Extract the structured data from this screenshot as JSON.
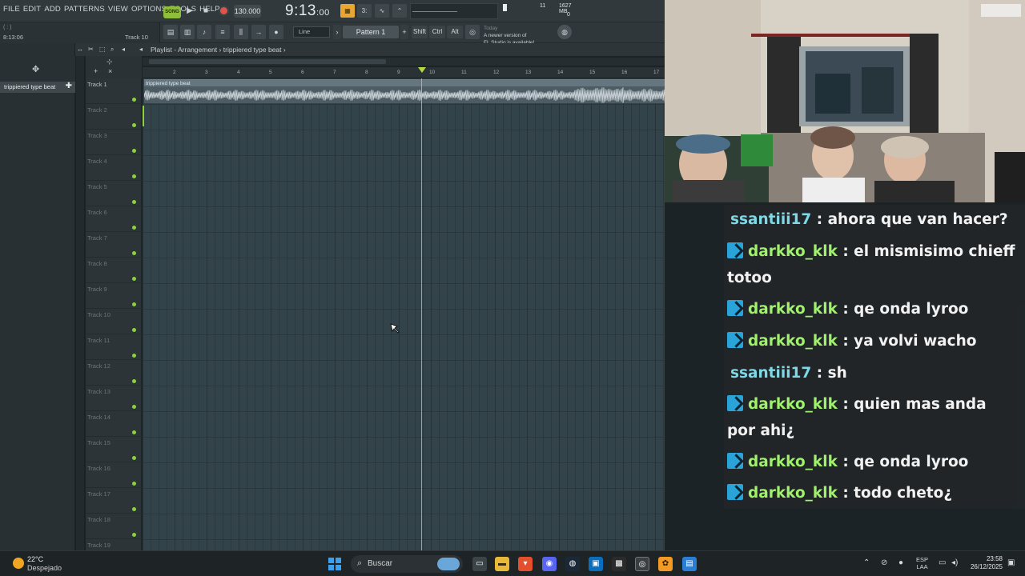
{
  "fl": {
    "menu": [
      "FILE",
      "EDIT",
      "ADD",
      "PATTERNS",
      "VIEW",
      "OPTIONS",
      "TOOLS",
      "HELP"
    ],
    "hint_top": "( : )",
    "hint_time": "8:13:06",
    "hint_track": "Track 10",
    "song_label": "SONG",
    "tempo": "130.000",
    "clock_main": "9:13",
    "clock_sub": ":00",
    "cpu_value": "11",
    "memory": "1627 MB",
    "poly": "0",
    "snap": "Line",
    "pattern": "Pattern 1",
    "modifiers": [
      "Shift",
      "Ctrl",
      "Alt"
    ],
    "news_label": "Today",
    "news_line1": "A newer version of",
    "news_line2": "FL Studio is available!",
    "breadcrumb": "Playlist - Arrangement",
    "breadcrumb_sep": "›",
    "breadcrumb_item": "trippiered type beat",
    "breadcrumb_tail": "›",
    "picker_pattern": "trippiered type beat",
    "clip_name": "trippiered type beat",
    "ruler": [
      "2",
      "3",
      "4",
      "5",
      "6",
      "7",
      "8",
      "9",
      "10",
      "11",
      "12",
      "13",
      "14",
      "15",
      "16",
      "17"
    ],
    "tracks": [
      "Track 1",
      "Track 2",
      "Track 3",
      "Track 4",
      "Track 5",
      "Track 6",
      "Track 7",
      "Track 8",
      "Track 9",
      "Track 10",
      "Track 11",
      "Track 12",
      "Track 13",
      "Track 14",
      "Track 15",
      "Track 16",
      "Track 17",
      "Track 18",
      "Track 19"
    ],
    "colors": {
      "accent": "#e8a733",
      "led": "#8fd13c",
      "record": "#e2534a",
      "grid": "#33434a"
    }
  },
  "chat": {
    "messages": [
      {
        "user": "ssantiii17",
        "sep": " : ",
        "text": "ahora que van hacer?",
        "badge": false,
        "color": "#7dd9e6"
      },
      {
        "user": "darkko_klk",
        "sep": " : ",
        "text": "el mismisimo chieff totoo",
        "badge": true,
        "color": "#9ff26a"
      },
      {
        "user": "darkko_klk",
        "sep": " : ",
        "text": "qe onda lyroo",
        "badge": true,
        "color": "#9ff26a"
      },
      {
        "user": "darkko_klk",
        "sep": " : ",
        "text": "ya volvi wacho",
        "badge": true,
        "color": "#9ff26a"
      },
      {
        "user": "ssantiii17",
        "sep": " : ",
        "text": "sh",
        "badge": false,
        "color": "#7dd9e6"
      },
      {
        "user": "darkko_klk",
        "sep": " : ",
        "text": "quien mas anda por ahi¿",
        "badge": true,
        "color": "#9ff26a"
      },
      {
        "user": "darkko_klk",
        "sep": " : ",
        "text": "qe onda lyroo",
        "badge": true,
        "color": "#9ff26a"
      },
      {
        "user": "darkko_klk",
        "sep": " : ",
        "text": "todo cheto¿",
        "badge": true,
        "color": "#9ff26a"
      }
    ]
  },
  "taskbar": {
    "temperature": "22°C",
    "weather": "Despejado",
    "search_label": "Buscar",
    "lang_top": "ESP",
    "lang_bottom": "LAA",
    "time": "23:58",
    "date": "26/12/2025"
  }
}
